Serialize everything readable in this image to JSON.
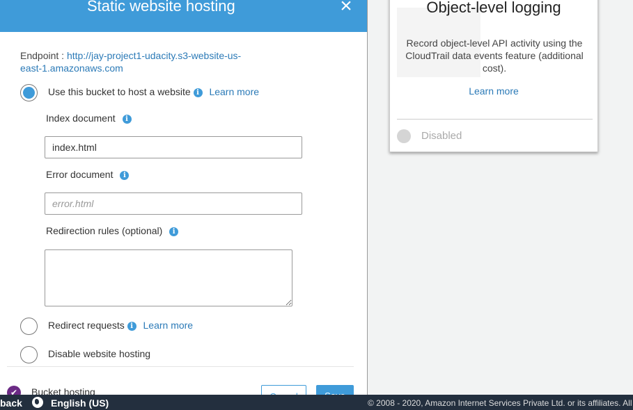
{
  "object_logging_card": {
    "title": "Object-level logging",
    "description": "Record object-level API activity using the CloudTrail data events feature (additional cost).",
    "learn_more": "Learn more",
    "status": "Disabled"
  },
  "modal": {
    "title": "Static website hosting",
    "close_icon": "×",
    "endpoint_label": "Endpoint : ",
    "endpoint_url": "http://jay-project1-udacity.s3-website-us-east-1.amazonaws.com",
    "options": [
      {
        "label": "Use this bucket to host a website",
        "learn_more": "Learn more",
        "selected": true
      },
      {
        "label": "Redirect requests",
        "learn_more": "Learn more",
        "selected": false
      },
      {
        "label": "Disable website hosting",
        "selected": false
      }
    ],
    "index_document": {
      "label": "Index document",
      "value": "index.html"
    },
    "error_document": {
      "label": "Error document",
      "placeholder": "error.html",
      "value": ""
    },
    "redirection_rules": {
      "label": "Redirection rules (optional)",
      "value": ""
    },
    "footer": {
      "bucket_label": "Bucket hosting",
      "cancel": "Cancel",
      "save": "Save"
    }
  },
  "bottom_bar": {
    "feedback": "back",
    "language": "English (US)",
    "copyright": "© 2008 - 2020, Amazon Internet Services Private Ltd. or its affiliates. All"
  },
  "colors": {
    "accent": "#3f9bd9",
    "link": "#2b7ab7",
    "bottom_bar": "#232f3e",
    "bucket_check": "#6b2a85"
  }
}
